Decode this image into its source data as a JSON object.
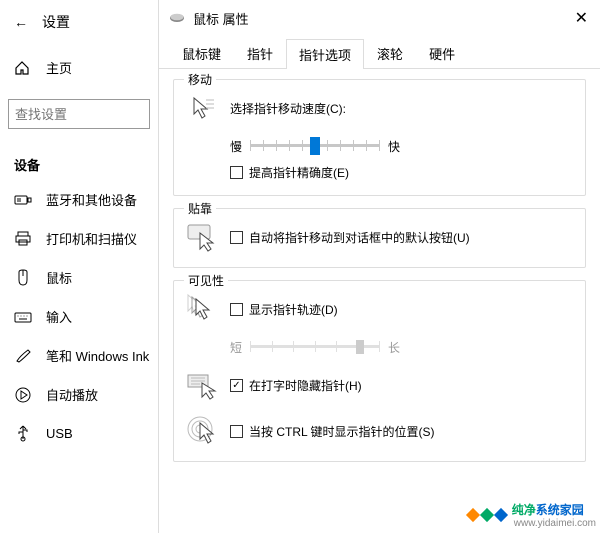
{
  "settings": {
    "title": "设置",
    "home": "主页",
    "search_placeholder": "查找设置",
    "category": "设备",
    "items": [
      {
        "label": "蓝牙和其他设备"
      },
      {
        "label": "打印机和扫描仪"
      },
      {
        "label": "鼠标"
      },
      {
        "label": "输入"
      },
      {
        "label": "笔和 Windows Ink"
      },
      {
        "label": "自动播放"
      },
      {
        "label": "USB"
      }
    ]
  },
  "dialog": {
    "title": "鼠标 属性",
    "tabs": [
      "鼠标键",
      "指针",
      "指针选项",
      "滚轮",
      "硬件"
    ],
    "active_tab": "指针选项",
    "motion": {
      "group": "移动",
      "speed_label": "选择指针移动速度(C):",
      "slow": "慢",
      "fast": "快",
      "enhance": "提高指针精确度(E)"
    },
    "snap": {
      "group": "贴靠",
      "label": "自动将指针移动到对话框中的默认按钮(U)"
    },
    "visibility": {
      "group": "可见性",
      "trails": "显示指针轨迹(D)",
      "short": "短",
      "long": "长",
      "hide": "在打字时隐藏指针(H)",
      "ctrl": "当按 CTRL 键时显示指针的位置(S)"
    }
  },
  "watermark": {
    "brand1": "纯净",
    "brand2": "系统家园",
    "url": "www.yidaimei.com"
  }
}
